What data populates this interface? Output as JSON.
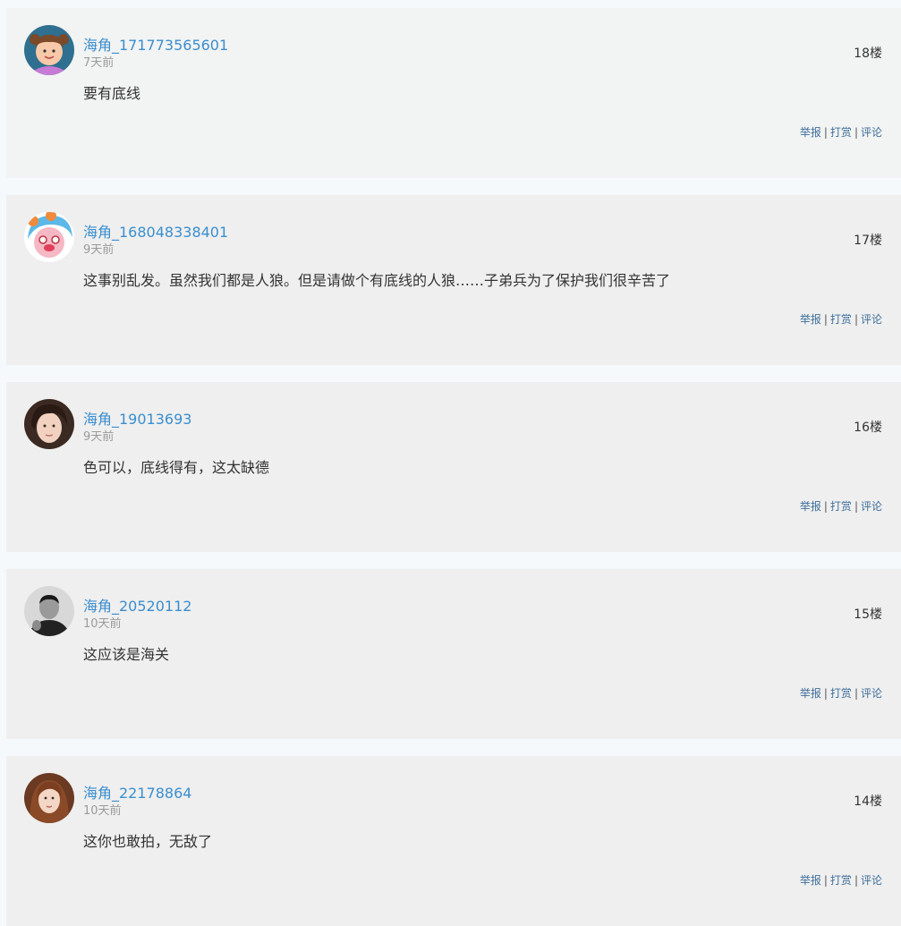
{
  "comments": [
    {
      "username": "海角_171773565601",
      "time": "7天前",
      "floor": "18楼",
      "content": "要有底线",
      "avatar_icon": "cartoon-girl-avatar",
      "actions": {
        "report": "举报",
        "tip": "打赏",
        "reply": "评论"
      }
    },
    {
      "username": "海角_168048338401",
      "time": "9天前",
      "floor": "17楼",
      "content": "这事别乱发。虽然我们都是人狼。但是请做个有底线的人狼……子弟兵为了保护我们很辛苦了",
      "avatar_icon": "cartoon-clown-avatar",
      "actions": {
        "report": "举报",
        "tip": "打赏",
        "reply": "评论"
      }
    },
    {
      "username": "海角_19013693",
      "time": "9天前",
      "floor": "16楼",
      "content": "色可以，底线得有，这太缺德",
      "avatar_icon": "woman-photo-avatar",
      "actions": {
        "report": "举报",
        "tip": "打赏",
        "reply": "评论"
      }
    },
    {
      "username": "海角_20520112",
      "time": "10天前",
      "floor": "15楼",
      "content": "这应该是海关",
      "avatar_icon": "man-photo-avatar",
      "actions": {
        "report": "举报",
        "tip": "打赏",
        "reply": "评论"
      }
    },
    {
      "username": "海角_22178864",
      "time": "10天前",
      "floor": "14楼",
      "content": "这你也敢拍，无敌了",
      "avatar_icon": "woman-photo-avatar",
      "actions": {
        "report": "举报",
        "tip": "打赏",
        "reply": "评论"
      }
    }
  ],
  "colors": {
    "username": "#3a8ecf",
    "card_bg": "#efefef",
    "page_bg": "#f6f9fb",
    "action_link": "#3d6e9a"
  }
}
